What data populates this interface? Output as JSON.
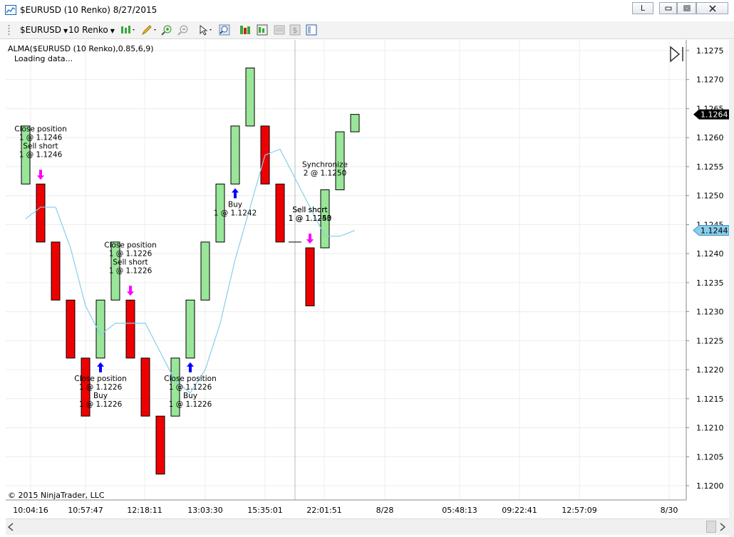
{
  "window": {
    "title": "$EURUSD (10 Renko)  8/27/2015",
    "controls": [
      "L",
      "minimize",
      "restore",
      "close"
    ],
    "link_button_label": "L"
  },
  "toolbar": {
    "instrument": "$EURUSD",
    "period": "10 Renko",
    "icons": [
      "chart-style-icon",
      "pencil-draw-icon",
      "zoom-in-icon",
      "zoom-out-icon",
      "cursor-pointer-icon",
      "magnify-icon",
      "strategies-icon",
      "indicators-icon",
      "properties-icon",
      "dollar-icon",
      "panel-icon"
    ]
  },
  "chart": {
    "indicator_label": "ALMA($EURUSD (10 Renko),0.85,6,9)",
    "status_text": "Loading data...",
    "copyright": "© 2015 NinjaTrader, LLC",
    "colors": {
      "up": "#99e699",
      "down": "#ee0000",
      "line": "#87ceeb",
      "buy_arrow": "#0000ff",
      "sell_arrow": "#ff00ff"
    },
    "price_ticks": [
      "1.1275",
      "1.1270",
      "1.1265",
      "1.1260",
      "1.1255",
      "1.1250",
      "1.1245",
      "1.1240",
      "1.1235",
      "1.1230",
      "1.1225",
      "1.1220",
      "1.1215",
      "1.1210",
      "1.1205",
      "1.1200"
    ],
    "last_price": "1.1264",
    "alma_value": "1.1244",
    "time_labels": [
      "10:04:16",
      "10:57:47",
      "12:18:11",
      "13:03:30",
      "15:35:01",
      "22:01:51",
      "8/28",
      "05:48:13",
      "09:22:41",
      "12:57:09",
      "8/30"
    ]
  },
  "chart_data": {
    "type": "renko",
    "instrument": "$EURUSD",
    "brick_size": 0.001,
    "bricks": [
      {
        "dir": "up",
        "open": 1.1252,
        "close": 1.1262
      },
      {
        "dir": "down",
        "open": 1.1252,
        "close": 1.1242
      },
      {
        "dir": "down",
        "open": 1.1242,
        "close": 1.1232
      },
      {
        "dir": "down",
        "open": 1.1232,
        "close": 1.1222
      },
      {
        "dir": "down",
        "open": 1.1222,
        "close": 1.1212
      },
      {
        "dir": "up",
        "open": 1.1222,
        "close": 1.1232
      },
      {
        "dir": "up",
        "open": 1.1232,
        "close": 1.1242
      },
      {
        "dir": "down",
        "open": 1.1232,
        "close": 1.1222
      },
      {
        "dir": "down",
        "open": 1.1222,
        "close": 1.1212
      },
      {
        "dir": "down",
        "open": 1.1212,
        "close": 1.1202
      },
      {
        "dir": "up",
        "open": 1.1212,
        "close": 1.1222
      },
      {
        "dir": "up",
        "open": 1.1222,
        "close": 1.1232
      },
      {
        "dir": "up",
        "open": 1.1232,
        "close": 1.1242
      },
      {
        "dir": "up",
        "open": 1.1242,
        "close": 1.1252
      },
      {
        "dir": "up",
        "open": 1.1252,
        "close": 1.1262
      },
      {
        "dir": "up",
        "open": 1.1262,
        "close": 1.1272
      },
      {
        "dir": "down",
        "open": 1.1262,
        "close": 1.1252
      },
      {
        "dir": "down",
        "open": 1.1252,
        "close": 1.1242
      },
      {
        "dir": "flat",
        "open": 1.1242,
        "close": 1.1242
      },
      {
        "dir": "down",
        "open": 1.1241,
        "close": 1.1231
      },
      {
        "dir": "up",
        "open": 1.1241,
        "close": 1.1251
      },
      {
        "dir": "up",
        "open": 1.1251,
        "close": 1.1261
      },
      {
        "dir": "up",
        "open": 1.1261,
        "close": 1.1264
      }
    ],
    "alma_line": [
      1.1246,
      1.1248,
      1.1248,
      1.1241,
      1.1231,
      1.1226,
      1.1228,
      1.1228,
      1.1228,
      1.1223,
      1.1218,
      1.1216,
      1.122,
      1.1228,
      1.1239,
      1.1248,
      1.1257,
      1.1258,
      1.1253,
      1.1248,
      1.1243,
      1.1243,
      1.1244
    ],
    "trades": [
      {
        "bar": 1,
        "type": "sell",
        "text": [
          "Close position",
          "1 @ 1.1246",
          "Sell short",
          "1 @ 1.1246"
        ]
      },
      {
        "bar": 5,
        "type": "buy",
        "text": [
          "Close position",
          "1 @ 1.1226",
          "Buy",
          "1 @ 1.1226"
        ]
      },
      {
        "bar": 7,
        "type": "sell",
        "text": [
          "Close position",
          "1 @ 1.1226",
          "Sell short",
          "1 @ 1.1226"
        ]
      },
      {
        "bar": 11,
        "type": "buy",
        "text": [
          "Close position",
          "1 @ 1.1226",
          "Buy",
          "1 @ 1.1226"
        ]
      },
      {
        "bar": 14,
        "type": "buy",
        "text": [
          "Buy",
          "1 @ 1.1242"
        ]
      },
      {
        "bar": 19,
        "type": "sell",
        "text": [
          "Sell short",
          "1 @ 1.1243"
        ]
      },
      {
        "bar": 19,
        "type": "sell",
        "text": [
          "Sell short",
          "1 @ 1.1250"
        ]
      },
      {
        "bar": 20,
        "type": "sync",
        "text": [
          "Synchronize",
          "2 @ 1.1250"
        ]
      }
    ],
    "ylim": [
      1.1197,
      1.1277
    ]
  }
}
